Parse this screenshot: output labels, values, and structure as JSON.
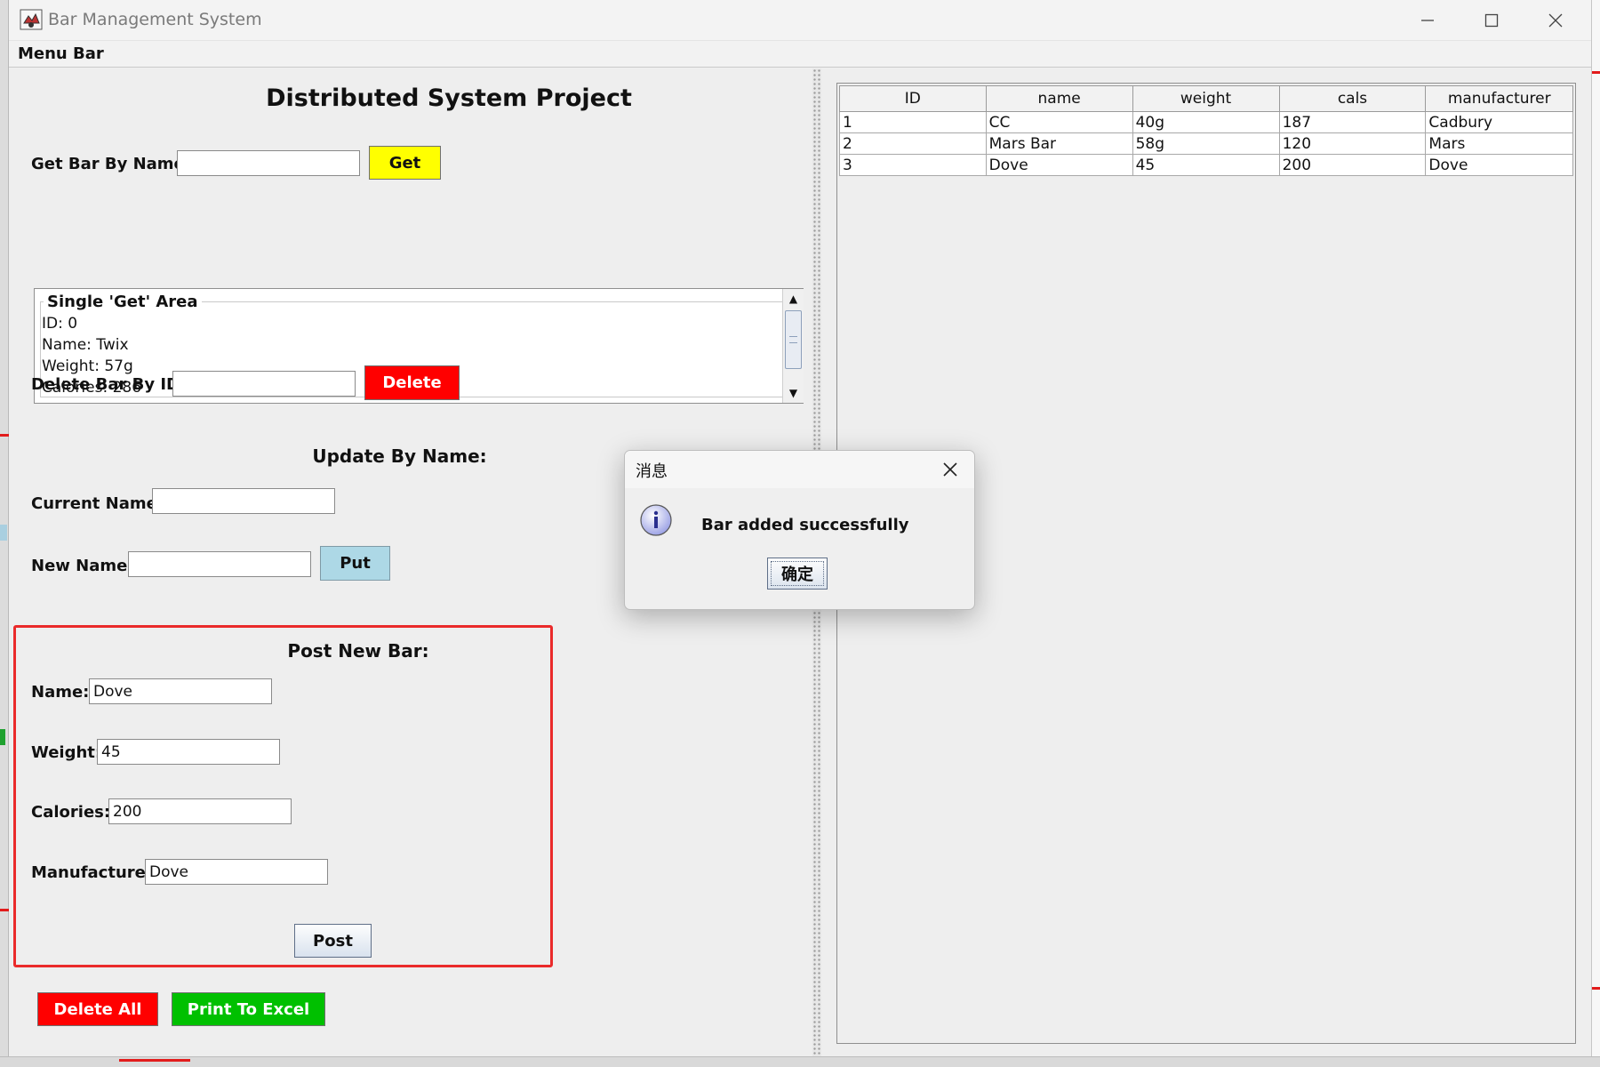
{
  "window": {
    "title": "Bar Management System",
    "menu_bar_label": "Menu Bar"
  },
  "left": {
    "project_title": "Distributed System Project",
    "get_by_name_label": "Get Bar By Name:",
    "get_by_name_value": "",
    "get_button": "Get",
    "single_get_area": {
      "title": "Single 'Get' Area",
      "lines": [
        "ID: 0",
        "Name: Twix",
        "Weight: 57g",
        "Calories: 286"
      ]
    },
    "delete_by_id_label": "Delete Bar By ID:",
    "delete_by_id_value": "",
    "delete_button": "Delete",
    "update_title": "Update By Name:",
    "current_name_label": "Current Name:",
    "current_name_value": "",
    "new_name_label": "New Name:",
    "new_name_value": "",
    "put_button": "Put",
    "post": {
      "title": "Post New Bar:",
      "name_label": "Name:",
      "name_value": "Dove",
      "weight_label": "Weight:",
      "weight_value": "45",
      "calories_label": "Calories:",
      "calories_value": "200",
      "manufacturer_label": "Manufacturer:",
      "manufacturer_value": "Dove",
      "post_button": "Post"
    },
    "delete_all_button": "Delete All",
    "print_excel_button": "Print To Excel"
  },
  "table": {
    "headers": [
      "ID",
      "name",
      "weight",
      "cals",
      "manufacturer"
    ],
    "rows": [
      [
        "1",
        "CC",
        "40g",
        "187",
        "Cadbury"
      ],
      [
        "2",
        "Mars Bar",
        "58g",
        "120",
        "Mars"
      ],
      [
        "3",
        "Dove",
        "45",
        "200",
        "Dove"
      ]
    ]
  },
  "dialog": {
    "title": "消息",
    "message": "Bar added successfully",
    "ok_button": "确定",
    "icon": "info-icon"
  },
  "colors": {
    "get_button": "#ffff00",
    "delete_button": "#ff0000",
    "put_button": "#add8e6",
    "delete_all_button": "#ff0000",
    "print_excel_button": "#00c000",
    "post_box_border": "#ea2a2a"
  }
}
